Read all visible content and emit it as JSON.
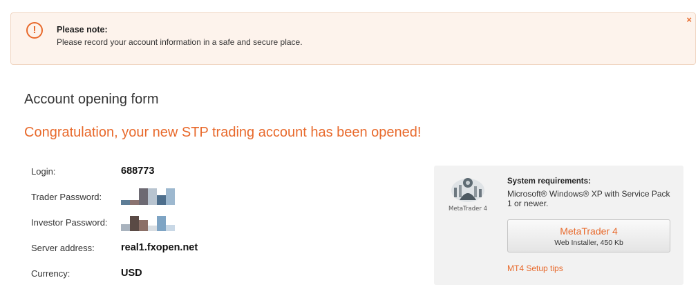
{
  "notice": {
    "title": "Please note:",
    "text": "Please record your account information in a safe and secure place.",
    "close": "×",
    "icon": "!"
  },
  "page_title": "Account opening form",
  "congrats": "Congratulation, your new STP trading account has been opened!",
  "account": {
    "login_label": "Login:",
    "login_value": "688773",
    "trader_password_label": "Trader Password:",
    "investor_password_label": "Investor Password:",
    "server_label": "Server address:",
    "server_value": "real1.fxopen.net",
    "currency_label": "Currency:",
    "currency_value": "USD"
  },
  "requirements": {
    "logo_text": "MetaTrader 4",
    "title": "System requirements:",
    "text": "Microsoft® Windows® XP with Service Pack 1 or newer.",
    "button_title": "MetaTrader 4",
    "button_sub": "Web Installer, 450 Kb",
    "setup_link": "MT4 Setup tips"
  },
  "colors": {
    "accent": "#e8692b",
    "notice_bg": "#fdf3ec",
    "panel_bg": "#f2f2f2"
  }
}
